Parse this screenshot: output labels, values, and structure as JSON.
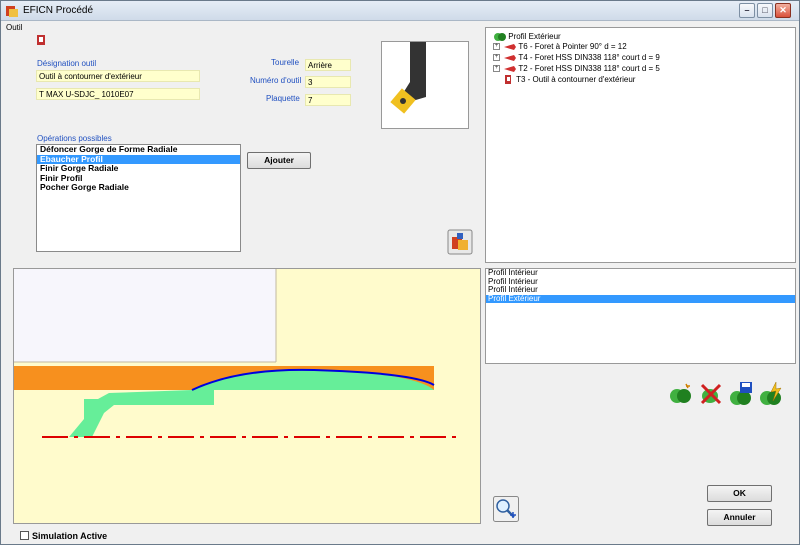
{
  "window": {
    "title": "EFICN Procédé",
    "minimize": "–",
    "maximize": "□",
    "close": "✕"
  },
  "outil_group": {
    "label": "Outil"
  },
  "designation": {
    "label": "Désignation outil",
    "value1": "Outil à contourner d'extérieur",
    "value2": "T MAX U-SDJC_ 1010E07"
  },
  "params": {
    "tourelle_label": "Tourelle",
    "tourelle_value": "Arrière",
    "numero_label": "Numéro d'outil",
    "numero_value": "3",
    "plaquette_label": "Plaquette",
    "plaquette_value": "7"
  },
  "operations": {
    "label": "Opérations possibles",
    "items": [
      "Défoncer Gorge de Forme Radiale",
      "Ebaucher Profil",
      "Finir Gorge Radiale",
      "Finir Profil",
      "Pocher Gorge Radiale"
    ],
    "selected_index": 1,
    "add_button": "Ajouter"
  },
  "tree": {
    "root": "Profil Extérieur",
    "children": [
      "T6 - Foret à Pointer 90° d = 12",
      "T4 - Foret HSS DIN338 118° court d = 9",
      "T2 - Foret HSS DIN338 118° court d = 5",
      "T3 - Outil à contourner d'extérieur"
    ]
  },
  "profiles": {
    "items": [
      "Profil Intérieur",
      "Profil Intérieur",
      "Profil Intérieur",
      "Profil Extérieur"
    ],
    "selected_index": 3
  },
  "actions": {
    "ok": "OK",
    "cancel": "Annuler"
  },
  "simulation": {
    "label": "Simulation Active",
    "checked": false
  },
  "colors": {
    "stock": "#f7901e",
    "part": "#66ee99",
    "background": "#fffbcc",
    "contour": "#0000dd",
    "axis": "#dd0000",
    "selection": "#3399ff"
  }
}
